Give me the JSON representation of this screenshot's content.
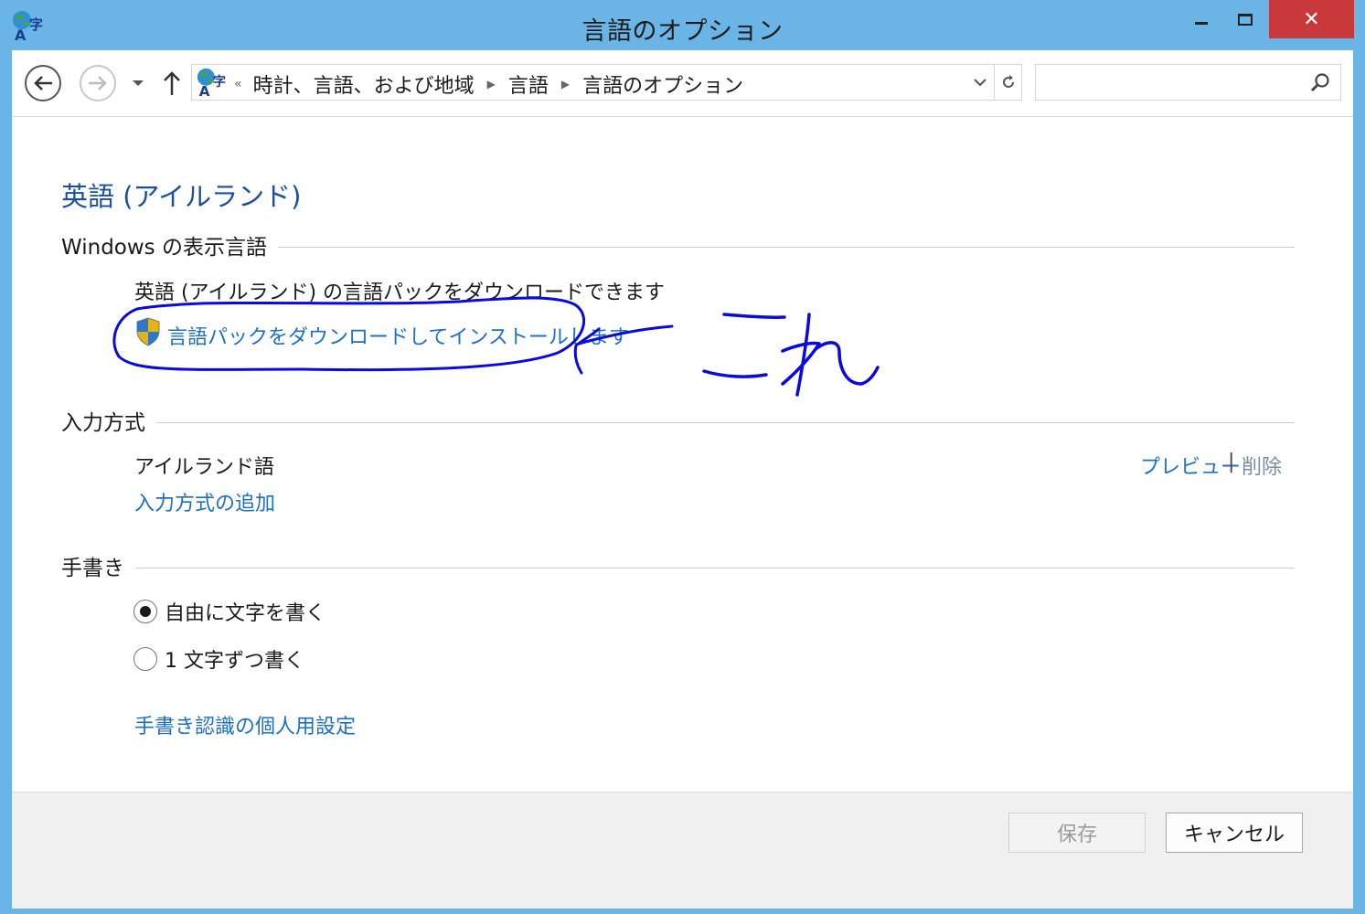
{
  "window": {
    "title": "言語のオプション",
    "close_glyph": "✕"
  },
  "navbar": {
    "breadcrumb": [
      "時計、言語、および地域",
      "言語",
      "言語のオプション"
    ],
    "overflow_glyph": "«",
    "search_placeholder": ""
  },
  "content": {
    "heading": "英語 (アイルランド)",
    "display_language": {
      "label": "Windows の表示言語",
      "description": "英語 (アイルランド) の言語パックをダウンロードできます",
      "download_link": "言語パックをダウンロードしてインストールします"
    },
    "input_method": {
      "label": "入力方式",
      "item": "アイルランド語",
      "preview_link": "プレビュー",
      "separator": "|",
      "remove_link": "削除",
      "add_link": "入力方式の追加"
    },
    "handwriting": {
      "label": "手書き",
      "options": [
        {
          "label": "自由に文字を書く",
          "selected": true
        },
        {
          "label": "1 文字ずつ書く",
          "selected": false
        }
      ],
      "personalize_link": "手書き認識の個人用設定"
    }
  },
  "footer": {
    "save_label": "保存",
    "cancel_label": "キャンセル",
    "save_enabled": false
  },
  "annotation": {
    "handwritten_text": "これ",
    "ink_color": "#0a0adf"
  },
  "colors": {
    "title_bar": "#6bb5e6",
    "close_button": "#c7393b",
    "link": "#1e6fc7",
    "heading": "#1c4fa1"
  },
  "icons": [
    "language-globe-icon",
    "back-arrow-icon",
    "forward-arrow-icon",
    "recent-pages-chevron-icon",
    "up-arrow-icon",
    "refresh-icon",
    "search-icon",
    "uac-shield-icon"
  ]
}
